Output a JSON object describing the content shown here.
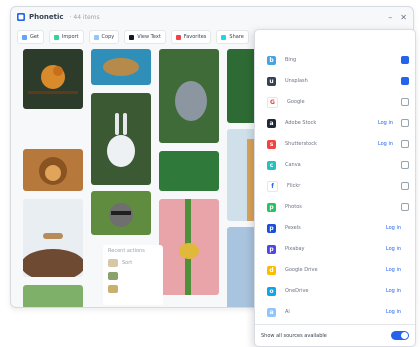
{
  "window": {
    "title": "Phonetic",
    "subtitle": "· 44 items",
    "controls": [
      "–",
      "✕"
    ]
  },
  "toolbar": {
    "items": [
      {
        "label": "Get",
        "color": "#60a5fa"
      },
      {
        "label": "Import",
        "color": "#34d399"
      },
      {
        "label": "Copy",
        "color": "#93c5fd"
      },
      {
        "label": "View Text",
        "color": "#111827"
      },
      {
        "label": "Favorites",
        "color": "#ef4444"
      },
      {
        "label": "Share",
        "color": "#22d3ee"
      }
    ]
  },
  "sidebar_card": {
    "heading": "Recent actions",
    "rows": [
      "Sort",
      "",
      ""
    ]
  },
  "accounts_panel": {
    "rows": [
      {
        "name": "Bing",
        "icon": "bing-icon",
        "color": "#4aa3df",
        "link": "",
        "checked": true
      },
      {
        "name": "Unsplash",
        "icon": "unsplash-icon",
        "color": "#374151",
        "link": "",
        "checked": true
      },
      {
        "name": "Google",
        "icon": "google-icon",
        "color": "#ea4335",
        "link": "",
        "checked": false
      },
      {
        "name": "Adobe Stock",
        "icon": "adobe-stock-icon",
        "color": "#1f2937",
        "link": "Log in",
        "checked": false
      },
      {
        "name": "Shutterstock",
        "icon": "shutterstock-icon",
        "color": "#ef4444",
        "link": "Log in",
        "checked": false
      },
      {
        "name": "Canva",
        "icon": "canva-icon",
        "color": "#22c1c3",
        "link": "",
        "checked": false
      },
      {
        "name": "Flickr",
        "icon": "flickr-icon",
        "color": "#2563eb",
        "link": "",
        "checked": false
      },
      {
        "name": "Photos",
        "icon": "photos-icon",
        "color": "#22c55e",
        "link": "",
        "checked": false
      },
      {
        "name": "Pexels",
        "icon": "pexels-icon",
        "color": "#1d4ed8",
        "link": "Log in",
        "checked": false
      },
      {
        "name": "Pixabay",
        "icon": "pixabay-icon",
        "color": "#4f46e5",
        "link": "Log in",
        "checked": false
      },
      {
        "name": "Google Drive",
        "icon": "drive-icon",
        "color": "#fbbc04",
        "link": "Log in",
        "checked": false
      },
      {
        "name": "OneDrive",
        "icon": "onedrive-icon",
        "color": "#0ea5e9",
        "link": "Log in",
        "checked": false
      },
      {
        "name": "Ai",
        "icon": "ai-icon",
        "color": "#93c5fd",
        "link": "Log in",
        "checked": false
      }
    ],
    "footer": {
      "label": "Show all sources available",
      "toggle_on": true
    }
  }
}
